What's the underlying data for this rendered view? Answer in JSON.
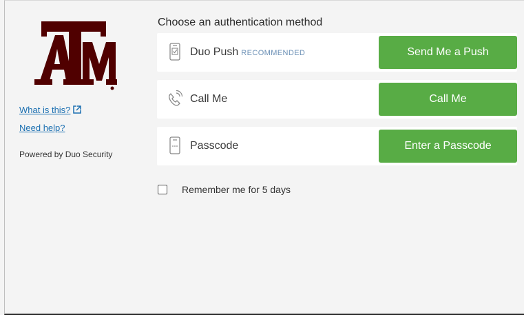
{
  "sidebar": {
    "logo_alt": "ATM",
    "what_is_this": "What is this?",
    "need_help": "Need help?",
    "powered_by": "Powered by Duo Security"
  },
  "main": {
    "heading": "Choose an authentication method",
    "methods": [
      {
        "label": "Duo Push",
        "badge": "RECOMMENDED",
        "icon": "phone-check-icon",
        "button": "Send Me a Push"
      },
      {
        "label": "Call Me",
        "badge": "",
        "icon": "phone-call-icon",
        "button": "Call Me"
      },
      {
        "label": "Passcode",
        "badge": "",
        "icon": "passcode-device-icon",
        "button": "Enter a Passcode"
      }
    ],
    "remember_label": "Remember me for 5 days",
    "remember_checked": false
  },
  "colors": {
    "brand": "#500000",
    "button": "#58ac45",
    "link": "#1b6fb1",
    "background": "#f4f4f4"
  }
}
